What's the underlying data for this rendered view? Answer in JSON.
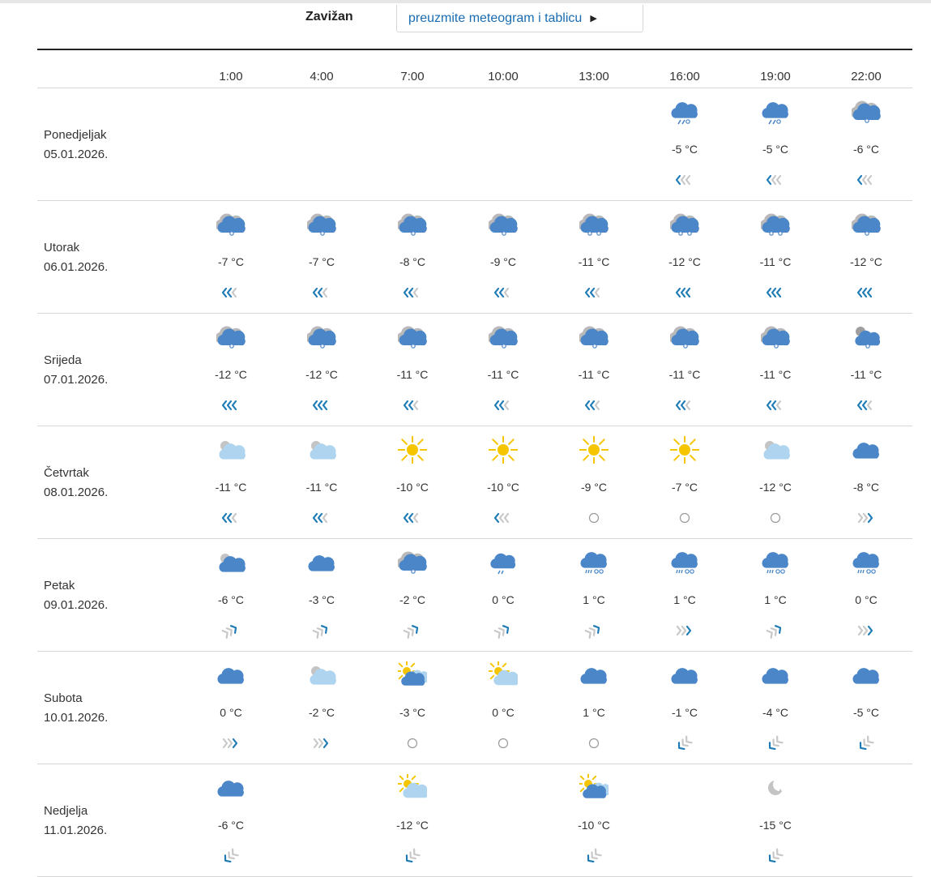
{
  "station": "Zavižan",
  "download_label": "preuzmite meteogram i tablicu",
  "hours": [
    "1:00",
    "4:00",
    "7:00",
    "10:00",
    "13:00",
    "16:00",
    "19:00",
    "22:00"
  ],
  "days": [
    {
      "name": "Ponedjeljak",
      "date": "05.01.2026.",
      "cells": [
        null,
        null,
        null,
        null,
        null,
        {
          "icon": "snow-heavy",
          "temp": "-5 °C",
          "wind": "wind-weak-west"
        },
        {
          "icon": "snow-heavy",
          "temp": "-5 °C",
          "wind": "wind-weak-west"
        },
        {
          "icon": "snow-cloud",
          "temp": "-6 °C",
          "wind": "wind-weak-west"
        }
      ]
    },
    {
      "name": "Utorak",
      "date": "06.01.2026.",
      "cells": [
        {
          "icon": "snow-cloud",
          "temp": "-7 °C",
          "wind": "wind-moderate-west"
        },
        {
          "icon": "snow-cloud",
          "temp": "-7 °C",
          "wind": "wind-moderate-west"
        },
        {
          "icon": "snow-cloud",
          "temp": "-8 °C",
          "wind": "wind-moderate-west"
        },
        {
          "icon": "snow-cloud",
          "temp": "-9 °C",
          "wind": "wind-moderate-west"
        },
        {
          "icon": "snow-cloud-heavy",
          "temp": "-11 °C",
          "wind": "wind-moderate-west"
        },
        {
          "icon": "snow-cloud-heavy",
          "temp": "-12 °C",
          "wind": "wind-strong-west"
        },
        {
          "icon": "snow-cloud-heavy",
          "temp": "-11 °C",
          "wind": "wind-strong-west"
        },
        {
          "icon": "snow-cloud",
          "temp": "-12 °C",
          "wind": "wind-strong-west"
        }
      ]
    },
    {
      "name": "Srijeda",
      "date": "07.01.2026.",
      "cells": [
        {
          "icon": "snow-cloud",
          "temp": "-12 °C",
          "wind": "wind-strong-west"
        },
        {
          "icon": "snow-cloud",
          "temp": "-12 °C",
          "wind": "wind-strong-west"
        },
        {
          "icon": "snow-cloud",
          "temp": "-11 °C",
          "wind": "wind-moderate-west"
        },
        {
          "icon": "snow-cloud",
          "temp": "-11 °C",
          "wind": "wind-moderate-west"
        },
        {
          "icon": "snow-cloud",
          "temp": "-11 °C",
          "wind": "wind-moderate-west"
        },
        {
          "icon": "snow-cloud",
          "temp": "-11 °C",
          "wind": "wind-moderate-west"
        },
        {
          "icon": "snow-cloud",
          "temp": "-11 °C",
          "wind": "wind-moderate-west"
        },
        {
          "icon": "partly-cloudy-snow",
          "temp": "-11 °C",
          "wind": "wind-moderate-west"
        }
      ]
    },
    {
      "name": "Četvrtak",
      "date": "08.01.2026.",
      "cells": [
        {
          "icon": "partly-cloudy-grey",
          "temp": "-11 °C",
          "wind": "wind-moderate-west"
        },
        {
          "icon": "partly-cloudy-grey",
          "temp": "-11 °C",
          "wind": "wind-moderate-west"
        },
        {
          "icon": "sun",
          "temp": "-10 °C",
          "wind": "wind-moderate-west"
        },
        {
          "icon": "sun",
          "temp": "-10 °C",
          "wind": "wind-weak-west"
        },
        {
          "icon": "sun",
          "temp": "-9 °C",
          "wind": "calm"
        },
        {
          "icon": "sun",
          "temp": "-7 °C",
          "wind": "calm"
        },
        {
          "icon": "partly-cloudy-grey",
          "temp": "-12 °C",
          "wind": "calm"
        },
        {
          "icon": "cloud",
          "temp": "-8 °C",
          "wind": "wind-east"
        }
      ]
    },
    {
      "name": "Petak",
      "date": "09.01.2026.",
      "cells": [
        {
          "icon": "partly-cloudy-dark",
          "temp": "-6 °C",
          "wind": "wind-northeast"
        },
        {
          "icon": "cloud",
          "temp": "-3 °C",
          "wind": "wind-northeast"
        },
        {
          "icon": "snow-cloud",
          "temp": "-2 °C",
          "wind": "wind-northeast"
        },
        {
          "icon": "sleet",
          "temp": "0 °C",
          "wind": "wind-northeast"
        },
        {
          "icon": "rain-snow",
          "temp": "1 °C",
          "wind": "wind-northeast"
        },
        {
          "icon": "rain-snow",
          "temp": "1 °C",
          "wind": "wind-east"
        },
        {
          "icon": "rain-snow",
          "temp": "1 °C",
          "wind": "wind-northeast"
        },
        {
          "icon": "rain-snow",
          "temp": "0 °C",
          "wind": "wind-east"
        }
      ]
    },
    {
      "name": "Subota",
      "date": "10.01.2026.",
      "cells": [
        {
          "icon": "cloud",
          "temp": "0 °C",
          "wind": "wind-east"
        },
        {
          "icon": "partly-cloudy-grey",
          "temp": "-2 °C",
          "wind": "wind-east"
        },
        {
          "icon": "sun-cloud-dark",
          "temp": "-3 °C",
          "wind": "calm"
        },
        {
          "icon": "sun-cloud-light",
          "temp": "0 °C",
          "wind": "calm"
        },
        {
          "icon": "cloud",
          "temp": "1 °C",
          "wind": "calm"
        },
        {
          "icon": "cloud",
          "temp": "-1 °C",
          "wind": "wind-southwest"
        },
        {
          "icon": "cloud",
          "temp": "-4 °C",
          "wind": "wind-southwest"
        },
        {
          "icon": "cloud",
          "temp": "-5 °C",
          "wind": "wind-southwest"
        }
      ]
    },
    {
      "name": "Nedjelja",
      "date": "11.01.2026.",
      "cells": [
        {
          "icon": "cloud",
          "temp": "-6 °C",
          "wind": "wind-southwest"
        },
        null,
        {
          "icon": "sun-cloud-light",
          "temp": "-12 °C",
          "wind": "wind-southwest"
        },
        null,
        {
          "icon": "sun-cloud-dark",
          "temp": "-10 °C",
          "wind": "wind-southwest"
        },
        null,
        {
          "icon": "moon-clear",
          "temp": "-15 °C",
          "wind": "wind-southwest"
        },
        null
      ]
    }
  ],
  "colors": {
    "cloud_blue": "#4a86c8",
    "cloud_light": "#aed4f0",
    "cloud_grey": "#c4c4c4",
    "sun": "#f5c500",
    "link": "#1a6cb1",
    "wind_dark": "#1f7bb5",
    "wind_light": "#c8c8c8"
  }
}
